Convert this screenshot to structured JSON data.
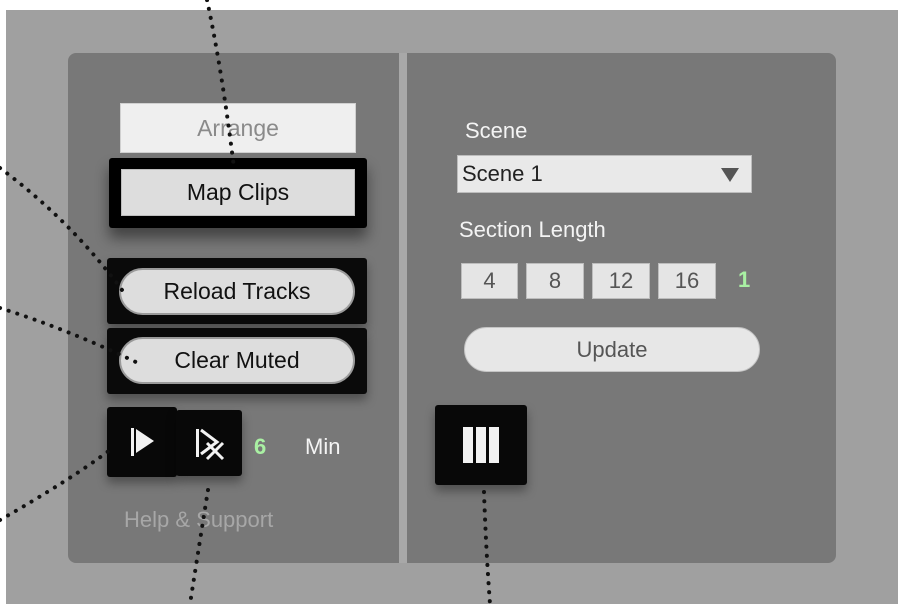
{
  "left_panel": {
    "arrange_label": "Arrange",
    "map_clips_label": "Map Clips",
    "reload_tracks_label": "Reload Tracks",
    "clear_muted_label": "Clear Muted",
    "count_value": "6",
    "min_label": "Min",
    "help_label": "Help & Support"
  },
  "right_panel": {
    "scene_label": "Scene",
    "scene_selected": "Scene 1",
    "section_length_label": "Section Length",
    "lengths": [
      "4",
      "8",
      "12",
      "16"
    ],
    "current_length": "1",
    "update_label": "Update"
  },
  "icons": {
    "flag": "flag-icon",
    "flag_remove": "flag-remove-icon",
    "columns": "columns-icon"
  },
  "colors": {
    "accent_green": "#a9f0a3",
    "panel_bg": "#787878",
    "backdrop": "#a0a0a0"
  }
}
